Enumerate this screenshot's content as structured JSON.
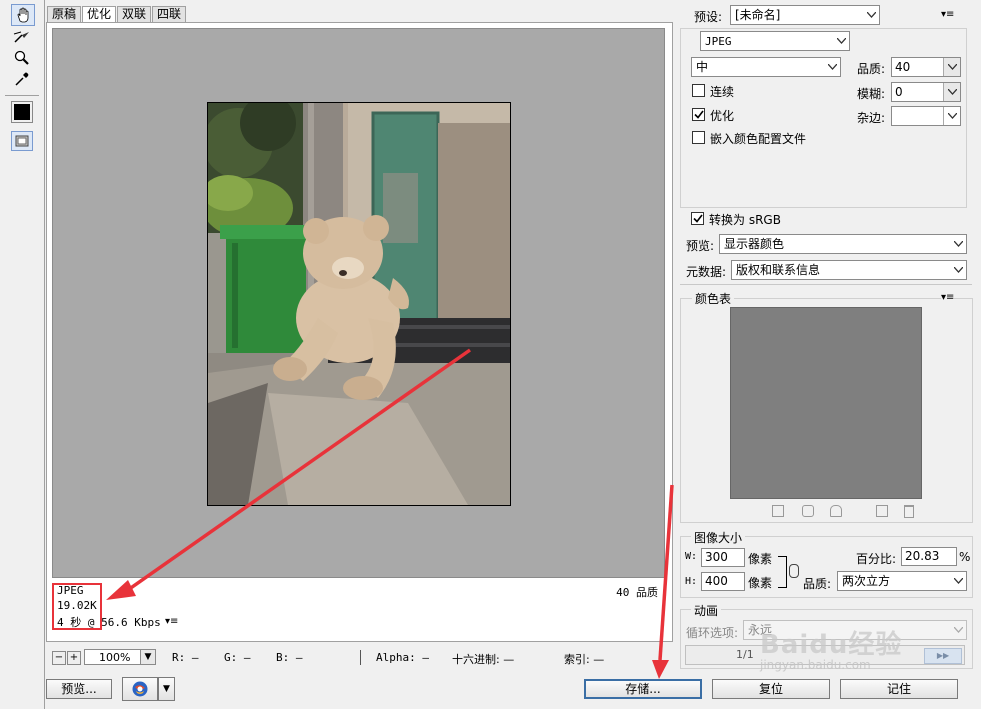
{
  "tools": [
    {
      "name": "hand-tool-icon"
    },
    {
      "name": "slice-select-tool-icon"
    },
    {
      "name": "zoom-tool-icon"
    },
    {
      "name": "eyedropper-tool-icon"
    }
  ],
  "tabs": {
    "original": "原稿",
    "optimized": "优化",
    "two_up": "双联",
    "four_up": "四联"
  },
  "preview": {
    "format": "JPEG",
    "size": "19.02K",
    "speed": "4 秒 @ 56.6 Kbps",
    "quality_label": "40 品质"
  },
  "status": {
    "zoom": "100%",
    "r": "R: —",
    "g": "G: —",
    "b": "B: —",
    "alpha": "Alpha: —",
    "hex": "十六进制: —",
    "index": "索引: —"
  },
  "buttons": {
    "preview": "预览...",
    "save": "存储...",
    "reset": "复位",
    "remember": "记住"
  },
  "settings": {
    "preset_label": "预设:",
    "preset_value": "[未命名]",
    "format_value": "JPEG",
    "quality_level": "中",
    "quality_label": "品质:",
    "quality_value": "40",
    "progressive_label": "连续",
    "blur_label": "模糊:",
    "blur_value": "0",
    "optimized_label": "优化",
    "matte_label": "杂边:",
    "embed_profile_label": "嵌入颜色配置文件",
    "convert_srgb_label": "转换为 sRGB",
    "preview_label": "预览:",
    "preview_value": "显示器颜色",
    "metadata_label": "元数据:",
    "metadata_value": "版权和联系信息"
  },
  "color_table": {
    "title": "颜色表",
    "swatch_color": "#7f7f7f"
  },
  "image_size": {
    "title": "图像大小",
    "w_label": "W:",
    "w_value": "300",
    "h_label": "H:",
    "h_value": "400",
    "unit": "像素",
    "percent_label": "百分比:",
    "percent_value": "20.83",
    "percent_sign": "%",
    "quality_label": "品质:",
    "quality_value": "两次立方"
  },
  "animation": {
    "title": "动画",
    "loop_label": "循环选项:",
    "loop_value": "永远",
    "frame_counter": "1/1"
  },
  "watermark": {
    "text": "Baidu经验",
    "sub": "jingyan.baidu.com"
  },
  "accent_colors": {
    "annotation_red": "#e8333a",
    "default_button_border": "#3a6ea5"
  }
}
